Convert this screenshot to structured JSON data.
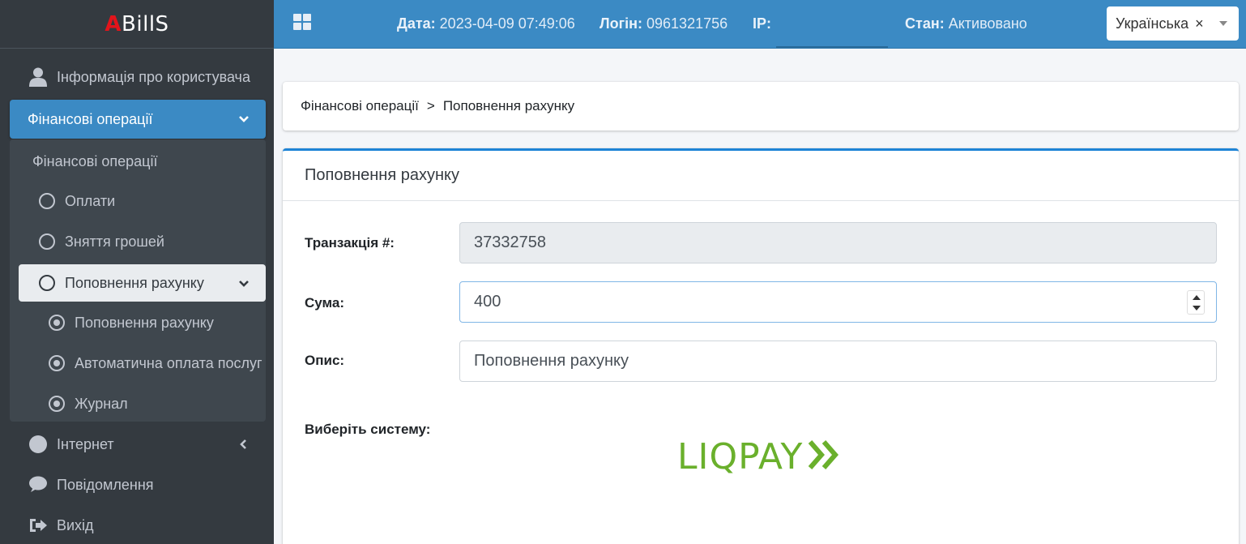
{
  "brand": {
    "first": "A",
    "rest": "BillS"
  },
  "sidebar": {
    "items": [
      {
        "label": "Інформація про користувача"
      },
      {
        "label": "Фінансові операції"
      },
      {
        "label": "Інтернет"
      },
      {
        "label": "Повідомлення"
      },
      {
        "label": "Вихід"
      }
    ],
    "submenu": {
      "header": "Фінансові операції",
      "items": [
        {
          "label": "Оплати"
        },
        {
          "label": "Зняття грошей"
        },
        {
          "label": "Поповнення рахунку"
        }
      ],
      "nested": [
        {
          "label": "Поповнення рахунку"
        },
        {
          "label": "Автоматична оплата послуг"
        },
        {
          "label": "Журнал"
        }
      ]
    }
  },
  "header": {
    "date_label": "Дата:",
    "date_value": "2023-04-09 07:49:06",
    "login_label": "Логін:",
    "login_value": "0961321756",
    "ip_label": "IP:",
    "ip_value": "",
    "state_label": "Стан:",
    "state_value": "Активовано",
    "language": "Українська",
    "language_clear": "×"
  },
  "breadcrumb": {
    "parent": "Фінансові операції",
    "separator": ">",
    "current": "Поповнення рахунку"
  },
  "form": {
    "title": "Поповнення рахунку",
    "transaction_label": "Транзакція #:",
    "transaction_value": "37332758",
    "sum_label": "Сума:",
    "sum_value": "400",
    "desc_label": "Опис:",
    "desc_value": "Поповнення рахунку",
    "system_label": "Виберіть систему:",
    "payment_system": "LIQPAY"
  },
  "colors": {
    "sidebar_bg": "#343a40",
    "accent": "#3b8ac4",
    "card_top": "#1e84d6",
    "liqpay_green": "#6ab02c"
  }
}
